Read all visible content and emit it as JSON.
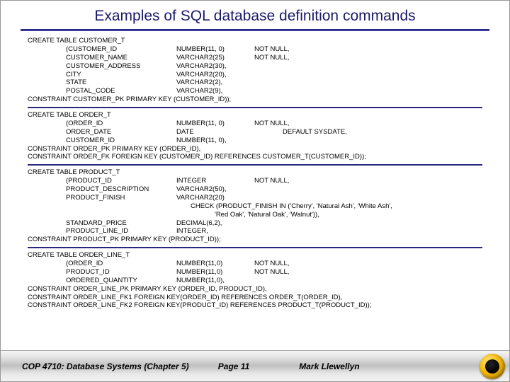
{
  "title": "Examples of SQL database definition commands",
  "blocks": [
    {
      "head": "CREATE TABLE CUSTOMER_T",
      "cols": [
        {
          "c1": "(CUSTOMER_ID",
          "c2": "NUMBER(11, 0)",
          "c3": "NOT NULL,"
        },
        {
          "c1": "CUSTOMER_NAME",
          "c2": "VARCHAR2(25)",
          "c3": "NOT NULL,"
        },
        {
          "c1": "CUSTOMER_ADDRESS",
          "c2": "VARCHAR2(30),",
          "c3": ""
        },
        {
          "c1": "CITY",
          "c2": "VARCHAR2(20),",
          "c3": ""
        },
        {
          "c1": "STATE",
          "c2": "VARCHAR2(2),",
          "c3": ""
        },
        {
          "c1": "POSTAL_CODE",
          "c2": "VARCHAR2(9),",
          "c3": ""
        }
      ],
      "tail": [
        "CONSTRAINT CUSTOMER_PK PRIMARY KEY (CUSTOMER_ID));"
      ]
    },
    {
      "head": "CREATE TABLE ORDER_T",
      "cols": [
        {
          "c1": "(ORDER_ID",
          "c2": "NUMBER(11, 0)",
          "c3": "NOT NULL,"
        },
        {
          "c1": "ORDER_DATE",
          "c2": "DATE",
          "c3": "DEFAULT SYSDATE,"
        },
        {
          "c1": "CUSTOMER_ID",
          "c2": "NUMBER(11, 0),",
          "c3": ""
        }
      ],
      "tail": [
        "CONSTRAINT ORDER_PK PRIMARY KEY (ORDER_ID),",
        "CONSTRAINT ORDER_FK FOREIGN KEY (CUSTOMER_ID) REFERENCES CUSTOMER_T(CUSTOMER_ID));"
      ]
    },
    {
      "head": "CREATE TABLE PRODUCT_T",
      "cols": [
        {
          "c1": "(PRODUCT_ID",
          "c2": "INTEGER",
          "c3": "NOT NULL,"
        },
        {
          "c1": "PRODUCT_DESCRIPTION",
          "c2": "VARCHAR2(50),",
          "c3": ""
        },
        {
          "c1": "PRODUCT_FINISH",
          "c2": "VARCHAR2(20)",
          "c3": ""
        }
      ],
      "check": [
        "CHECK (PRODUCT_FINISH IN ('Cherry', 'Natural Ash', 'White Ash',",
        "'Red Oak', 'Natural Oak', 'Walnut')),"
      ],
      "cols2": [
        {
          "c1": "STANDARD_PRICE",
          "c2": "DECIMAL(6,2),",
          "c3": ""
        },
        {
          "c1": "PRODUCT_LINE_ID",
          "c2": "INTEGER,",
          "c3": ""
        }
      ],
      "tail": [
        "CONSTRAINT PRODUCT_PK PRIMARY KEY (PRODUCT_ID));"
      ]
    },
    {
      "head": "CREATE TABLE ORDER_LINE_T",
      "cols": [
        {
          "c1": "(ORDER_ID",
          "c2": "NUMBER(11,0)",
          "c3": "NOT NULL,"
        },
        {
          "c1": "PRODUCT_ID",
          "c2": "NUMBER(11,0)",
          "c3": "NOT NULL,"
        },
        {
          "c1": "ORDERED_QUANTITY",
          "c2": "NUMBER(11,0),",
          "c3": ""
        }
      ],
      "tail": [
        "CONSTRAINT ORDER_LINE_PK PRIMARY KEY (ORDER_ID, PRODUCT_ID),",
        "CONSTRAINT ORDER_LINE_FK1 FOREIGN KEY(ORDER_ID) REFERENCES ORDER_T(ORDER_ID),",
        "CONSTRAINT ORDER_LINE_FK2 FOREIGN KEY(PRODUCT_ID) REFERENCES PRODUCT_T(PRODUCT_ID));"
      ]
    }
  ],
  "footer": {
    "left": "COP 4710: Database Systems  (Chapter 5)",
    "center": "Page 11",
    "right": "Mark Llewellyn"
  }
}
